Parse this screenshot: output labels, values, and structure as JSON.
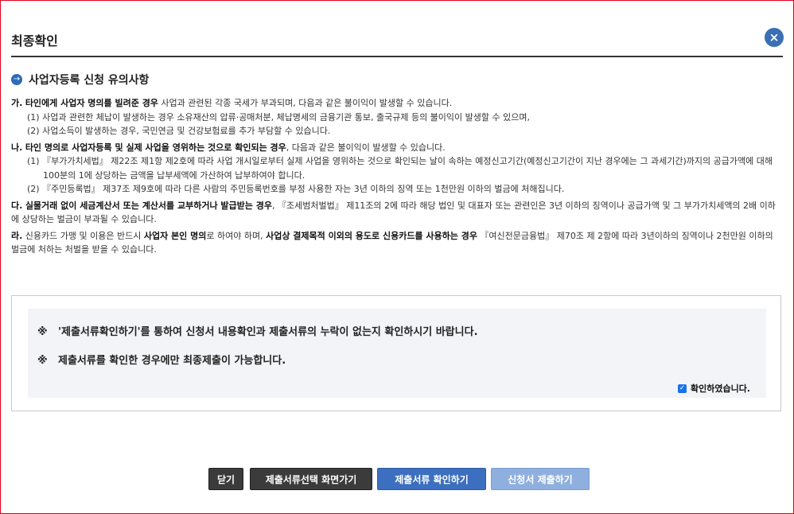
{
  "header": {
    "title": "최종확인",
    "close_icon": "×"
  },
  "section": {
    "title": "사업자등록 신청 유의사항",
    "icon": "→"
  },
  "notices": {
    "ga": {
      "marker": "가.",
      "bold": "타인에게 사업자 명의를 빌려준 경우",
      "text": " 사업과 관련된 각종 국세가 부과되며, 다음과 같은 불이익이 발생할 수 있습니다.",
      "sub1": "(1) 사업과 관련한 체납이 발생하는 경우 소유재산의 압류·공매처분, 체납명세의 금융기관 통보, 출국규제 등의 불이익이 발생할 수 있으며,",
      "sub2": "(2) 사업소득이 발생하는 경우, 국민연금 및 건강보험료를 추가 부담할 수 있습니다."
    },
    "na": {
      "marker": "나.",
      "bold": "타인 명의로 사업자등록 및 실제 사업을 영위하는 것으로 확인되는 경우",
      "text": ", 다음과 같은 불이익이 발생할 수 있습니다.",
      "sub1": "(1) 『부가가치세법』 제22조 제1항 제2호에 따라 사업 개시일로부터 실제 사업을 영위하는 것으로 확인되는 날이 속하는 예정신고기간(예정신고기간이 지난 경우에는 그 과세기간)까지의 공급가액에 대해 100분의 1에 상당하는 금액을 납부세액에 가산하여 납부하여야 합니다.",
      "sub2": "(2) 『주민등록법』 제37조 제9호에 따라 다른 사람의 주민등록번호를 부정 사용한 자는 3년 이하의 징역 또는 1천만원 이하의 벌금에 처해집니다."
    },
    "da": {
      "marker": "다.",
      "bold": "실물거래 없이 세금계산서 또는 계산서를 교부하거나 발급받는 경우",
      "text": ", 『조세범처벌법』 제11조의 2에 따라 해당 법인 및 대표자 또는 관련인은 3년 이하의 징역이나 공급가액 및 그 부가가치세액의 2배 이하에 상당하는 벌금이 부과될 수 있습니다."
    },
    "ra": {
      "marker": "라.",
      "text1": " 신용카드 가맹 및 이용은 반드시 ",
      "bold1": "사업자 본인 명의",
      "text2": "로 하여야 하며, ",
      "bold2": "사업상 결제목적 이외의 용도로 신용카드를 사용하는 경우",
      "text3": " 『여신전문금융법』 제70조 제 2항에 따라 3년이하의 징역이나 2천만원 이하의 벌금에 처하는 처벌을 받을 수 있습니다."
    }
  },
  "confirm": {
    "mark": "※",
    "line1": "'제출서류확인하기'를 통하여 신청서 내용확인과 제출서류의 누락이 없는지 확인하시기 바랍니다.",
    "line2": "제출서류를 확인한 경우에만 최종제출이 가능합니다.",
    "check_label": "확인하였습니다.",
    "check_mark": "✓",
    "checked": true
  },
  "buttons": {
    "close": "닫기",
    "go_select": "제출서류선택 화면가기",
    "check_docs": "제출서류 확인하기",
    "submit": "신청서 제출하기"
  },
  "colors": {
    "frame_border": "#e0001a",
    "accent_blue": "#3c6fbf",
    "submit_disabled": "#8fb0de",
    "dark_button": "#3b3b3b"
  }
}
